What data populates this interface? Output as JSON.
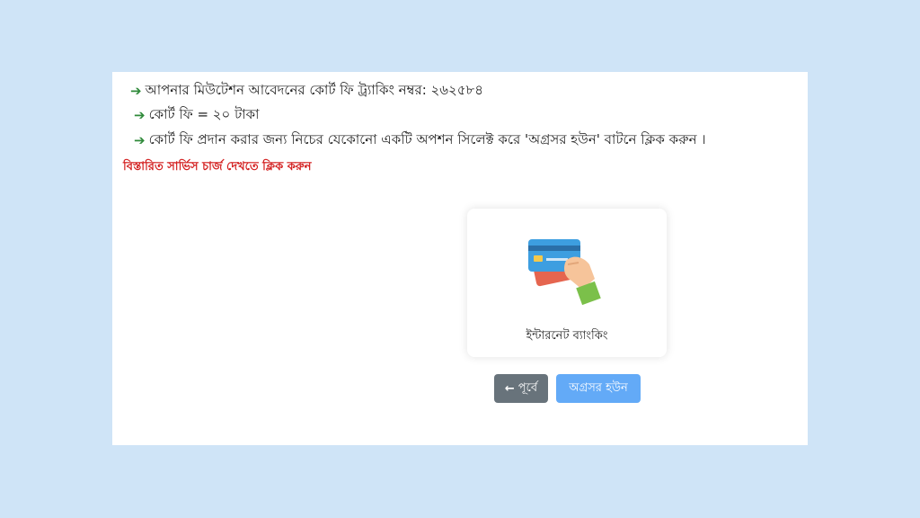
{
  "info": {
    "arrow": "➔",
    "line1": "আপনার মিউটেশন আবেদনের কোর্ট ফি ট্র্যাকিং নম্বর: ২৬২৫৮৪",
    "line2": "কোর্ট ফি = ২০ টাকা",
    "line3": "কোর্ট ফি প্রদান করার জন্য নিচের যেকোনো একটি অপশন সিলেক্ট করে 'অগ্রসর হউন' বাটনে ক্লিক করুন ।"
  },
  "service_charge_link": "বিস্তারিত সার্ভিস চার্জ দেখতে ক্লিক করুন",
  "payment_option": {
    "label": "ইন্টারনেট ব্যাংকিং",
    "icon": "card-payment-icon"
  },
  "buttons": {
    "back_icon": "←",
    "back_label": "পূর্বে",
    "next_label": "অগ্রসর হউন"
  },
  "colors": {
    "background": "#cfe4f7",
    "arrow_green": "#2f8a3a",
    "link_red": "#d31e1e",
    "back_button": "#68737b",
    "next_button": "#63aaf7"
  }
}
